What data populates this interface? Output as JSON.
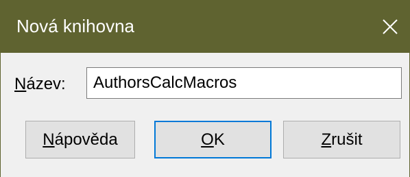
{
  "window": {
    "title": "Nová knihovna",
    "close_icon": "close-icon"
  },
  "form": {
    "name_label_accel": "N",
    "name_label_rest": "ázev:",
    "name_value": "AuthorsCalcMacros"
  },
  "buttons": {
    "help_accel": "N",
    "help_rest": "ápověda",
    "ok_accel": "O",
    "ok_rest": "K",
    "cancel_accel": "Z",
    "cancel_rest": "rušit"
  },
  "colors": {
    "titlebar": "#5f6330",
    "focus_border": "#0078d7"
  }
}
